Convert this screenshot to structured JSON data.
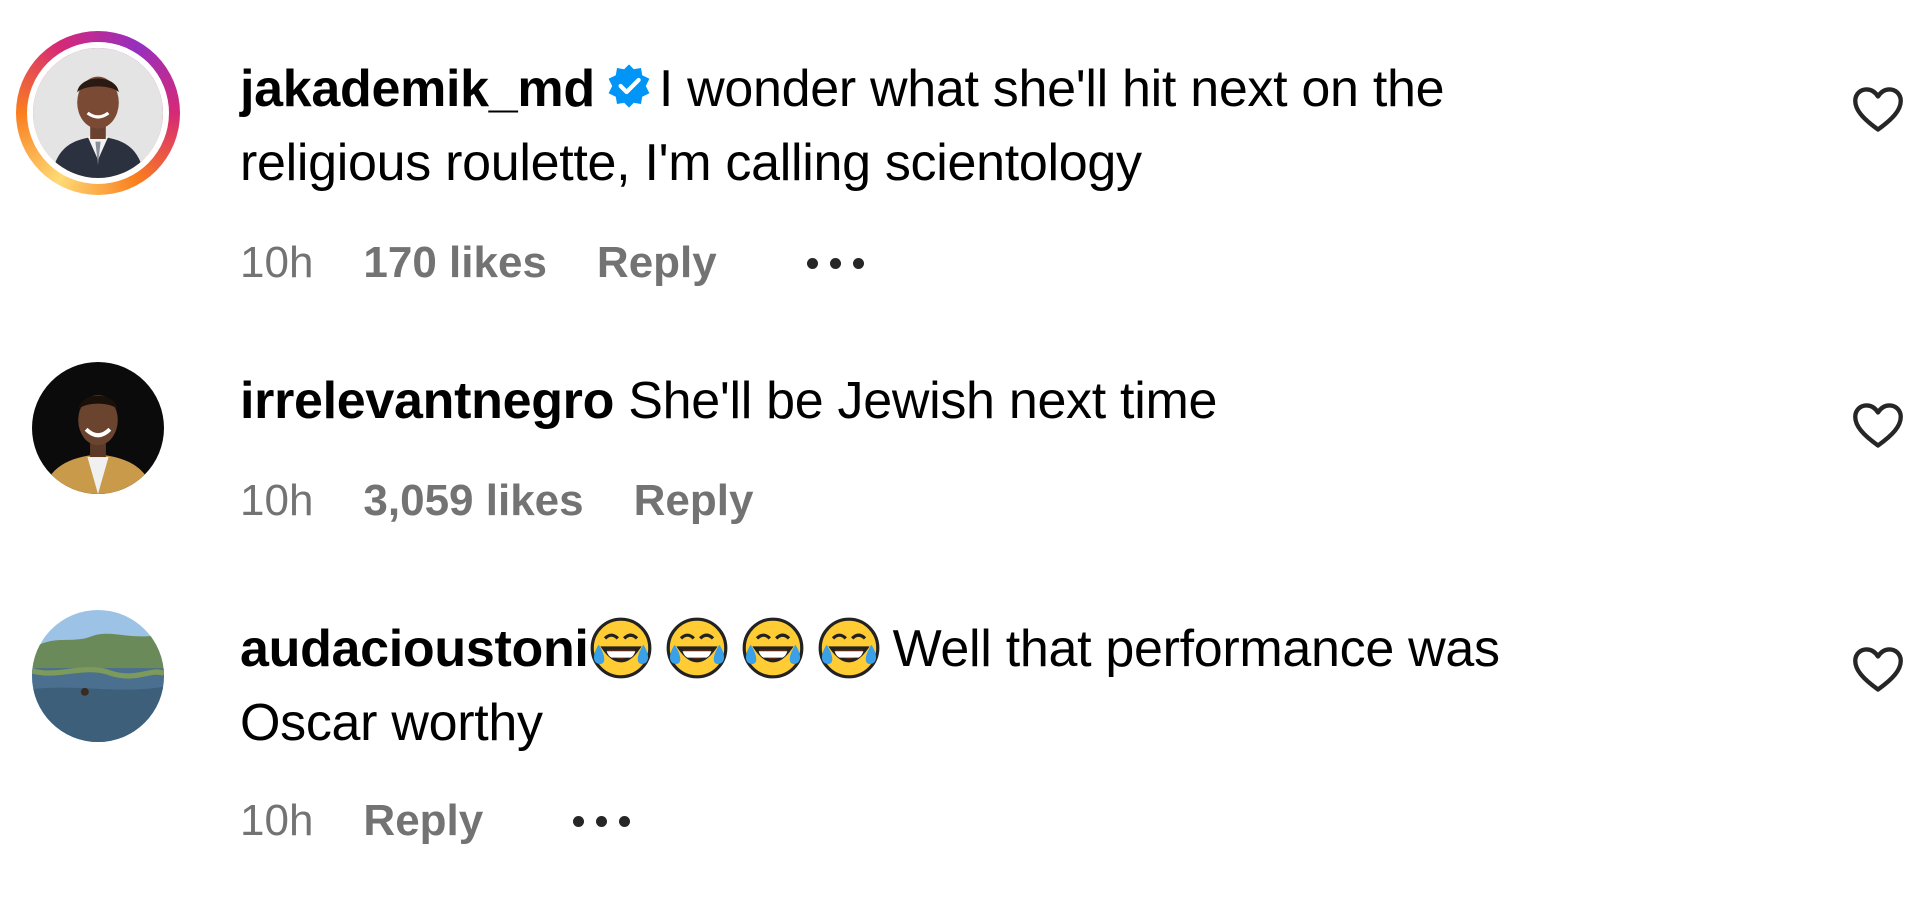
{
  "comments": [
    {
      "username": "jakademik_md",
      "verified": true,
      "has_story_ring": true,
      "text_line1": "I wonder what she'll hit next on the",
      "text_line2": "religious roulette, I'm calling scientology",
      "time": "10h",
      "likes": "170 likes",
      "reply": "Reply",
      "has_more_menu": true
    },
    {
      "username": "irrelevantnegro",
      "verified": false,
      "has_story_ring": false,
      "text_line1": "She'll be Jewish next time",
      "time": "10h",
      "likes": "3,059 likes",
      "reply": "Reply",
      "has_more_menu": false
    },
    {
      "username": "audacioustoni",
      "verified": false,
      "has_story_ring": false,
      "emojis": [
        "😂",
        "😂",
        "😂",
        "😂"
      ],
      "text_line1": "Well that performance was",
      "text_line2": "Oscar worthy",
      "time": "10h",
      "reply": "Reply",
      "has_more_menu": true
    }
  ],
  "icons": {
    "like": "heart-outline-icon",
    "verified": "verified-badge-icon",
    "more": "more-dots-icon"
  },
  "colors": {
    "text": "#000000",
    "meta": "#737373",
    "verified": "#0095f6"
  }
}
